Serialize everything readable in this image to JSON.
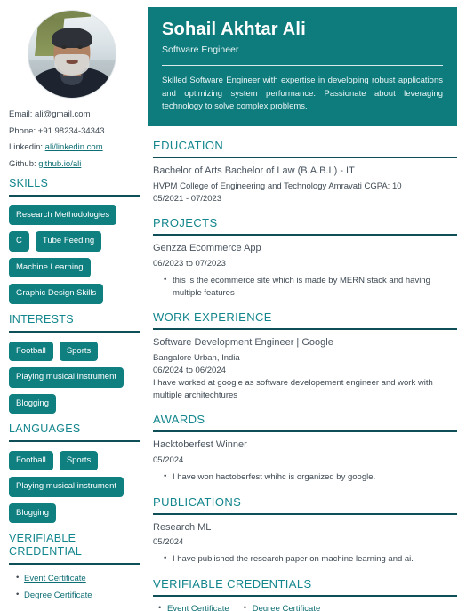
{
  "profile": {
    "photo_alt": "portrait-photo",
    "name": "Sohail Akhtar Ali",
    "role": "Software Engineer",
    "summary": "Skilled Software Engineer with expertise in developing robust applications and optimizing system performance. Passionate about leveraging technology to solve complex problems."
  },
  "contact": {
    "email_label": "Email:",
    "email_value": "ali@gmail.com",
    "phone_label": "Phone:",
    "phone_value": "+91 98234-34343",
    "linkedin_label": "Linkedin:",
    "linkedin_value": "ali/linkedin.com",
    "github_label": "Github:",
    "github_value": "github.io/ali"
  },
  "sidebar": {
    "skills": {
      "heading": "SKILLS",
      "items": [
        "Research Methodologies",
        "C",
        "Tube Feeding",
        "Machine Learning",
        "Graphic Design Skills"
      ]
    },
    "interests": {
      "heading": "INTERESTS",
      "items": [
        "Football",
        "Sports",
        "Playing musical instrument",
        "Blogging"
      ]
    },
    "languages": {
      "heading": "LANGUAGES",
      "items": [
        "Football",
        "Sports",
        "Playing musical instrument",
        "Blogging"
      ]
    },
    "verifiable_credential": {
      "heading": "VERIFIABLE CREDENTIAL",
      "items": [
        "Event Certificate",
        "Degree Certificate"
      ]
    }
  },
  "main": {
    "education": {
      "heading": "EDUCATION",
      "degree": "Bachelor of Arts Bachelor of Law (B.A.B.L) - IT",
      "institution": "HVPM College of Engineering and Technology Amravati CGPA: 10",
      "dates": "05/2021 - 07/2023"
    },
    "projects": {
      "heading": "PROJECTS",
      "title": "Genzza Ecommerce App",
      "dates": "06/2023 to 07/2023",
      "bullets": [
        "this is the ecommerce site which is made by MERN stack and having multiple features"
      ]
    },
    "work_experience": {
      "heading": "WORK EXPERIENCE",
      "title": "Software Development Engineer | Google",
      "location": "Bangalore Urban, India",
      "dates": "06/2024 to 06/2024",
      "description": "I have worked at google as software developement engineer and work with multiple architechtures"
    },
    "awards": {
      "heading": "AWARDS",
      "title": "Hacktoberfest Winner",
      "dates": "05/2024",
      "bullets": [
        "I have won hactoberfest whihc is organized by google."
      ]
    },
    "publications": {
      "heading": "PUBLICATIONS",
      "title": "Research ML",
      "dates": "05/2024",
      "bullets": [
        "I have published the research paper on machine learning and ai."
      ]
    },
    "verifiable_credentials": {
      "heading": "VERIFIABLE CREDENTIALS",
      "items": [
        "Event Certificate",
        "Degree Certificate"
      ]
    }
  },
  "colors": {
    "teal_banner": "#0e7b7d",
    "teal_pill": "#0f7f80",
    "teal_heading": "#13868d",
    "rule_dark": "#0f4f57",
    "link": "#0d6e74",
    "body_text": "#3d4852"
  }
}
